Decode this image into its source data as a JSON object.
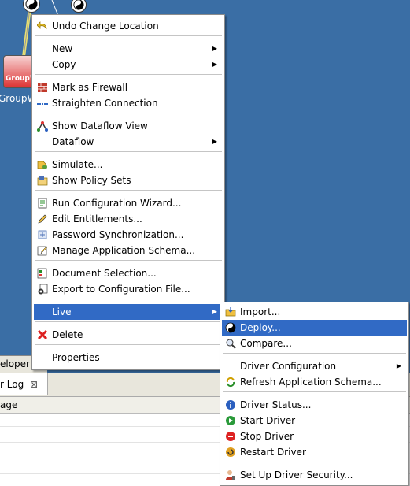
{
  "canvas": {
    "groupwise_icon_text": "GroupW",
    "groupwise_caption": "GroupWi"
  },
  "bottom": {
    "developer_tab": "eloper",
    "log_tab": "r Log",
    "log_tab_close": "⊠",
    "log_column_header": "age"
  },
  "main_menu": {
    "undo": "Undo Change Location",
    "new": "New",
    "copy": "Copy",
    "mark_firewall": "Mark as Firewall",
    "straighten": "Straighten Connection",
    "show_dataflow": "Show Dataflow View",
    "dataflow": "Dataflow",
    "simulate": "Simulate...",
    "show_policy_sets": "Show Policy Sets",
    "run_wizard": "Run Configuration Wizard...",
    "edit_entitlements": "Edit Entitlements...",
    "password_sync": "Password Synchronization...",
    "manage_schema": "Manage Application Schema...",
    "document_selection": "Document Selection...",
    "export_config": "Export to Configuration File...",
    "live": "Live",
    "delete": "Delete",
    "properties": "Properties"
  },
  "live_menu": {
    "import": "Import...",
    "deploy": "Deploy...",
    "compare": "Compare...",
    "driver_configuration": "Driver Configuration",
    "refresh_schema": "Refresh Application Schema...",
    "driver_status": "Driver Status...",
    "start_driver": "Start Driver",
    "stop_driver": "Stop Driver",
    "restart_driver": "Restart Driver",
    "setup_security": "Set Up Driver Security..."
  },
  "colors": {
    "canvas_bg": "#3a6ea5",
    "selection": "#316ac5",
    "connector": "#e8e070"
  }
}
